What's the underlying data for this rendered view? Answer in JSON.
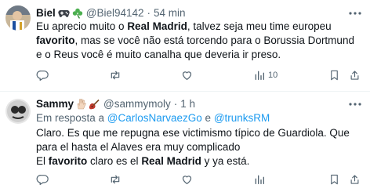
{
  "tweets": [
    {
      "name": "Biel",
      "emoji_icons": [
        "gamepad-icon",
        "shamrock-icon"
      ],
      "handle": "@Biel94142",
      "dot": "·",
      "time": "54 min",
      "text_parts": [
        "Eu aprecio muito o ",
        "Real Madrid",
        ", talvez seja meu time europeu ",
        "favorito",
        ", mas se você não está torcendo para o Borussia Dortmund e o Reus você é muito canalha que deveria ir preso."
      ],
      "views": "10"
    },
    {
      "name": "Sammy",
      "emoji_icons": [
        "hand-icon",
        "guitar-icon"
      ],
      "handle": "@sammymoly",
      "dot": "·",
      "time": "1 h",
      "reply_prefix": "Em resposta a ",
      "reply_mention_1": "@CarlosNarvaezGo",
      "reply_and": " e ",
      "reply_mention_2": "@trunksRM",
      "text_line1": "Claro. Es que me repugna ese victimismo típico de Guardiola. Que para el hasta el Alaves era muy complicado",
      "text_parts": [
        "El ",
        "favorito",
        " claro es el ",
        "Real Madrid",
        " y ya está."
      ],
      "views": ""
    }
  ],
  "colors": {
    "text": "#0f1419",
    "muted": "#536471",
    "link": "#1d9bf0",
    "divider": "#eff3f4"
  }
}
